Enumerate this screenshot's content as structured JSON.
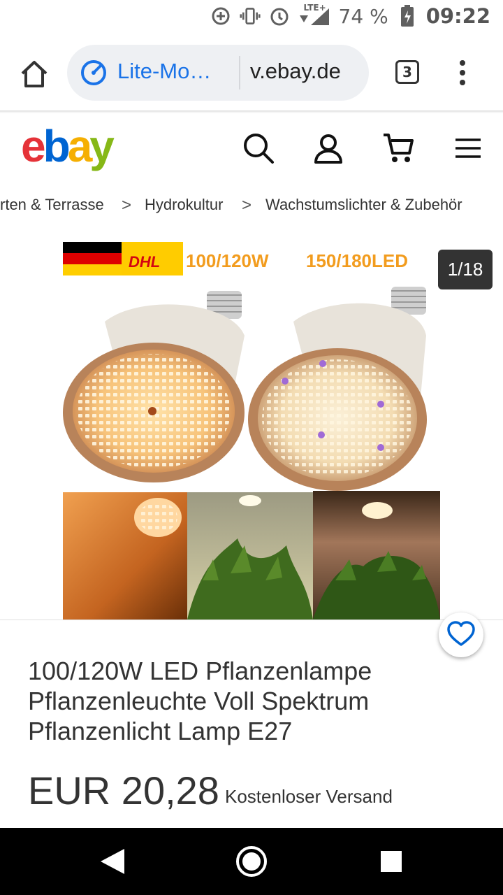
{
  "status_bar": {
    "icons": [
      "data-saver-icon",
      "vibrate-icon",
      "alarm-icon",
      "signal-icon",
      "battery-icon"
    ],
    "network": "LTE+",
    "battery": "74 %",
    "time": "09:22"
  },
  "browser": {
    "lite_mode_label": "Lite-Mo…",
    "url": "v.ebay.de",
    "tab_count": "3"
  },
  "ebay": {
    "logo": {
      "e": "e",
      "b": "b",
      "a": "a",
      "y": "y"
    },
    "icons": [
      "search-icon",
      "account-icon",
      "cart-icon",
      "hamburger-menu-icon"
    ]
  },
  "breadcrumb": {
    "items": [
      "rten & Terrasse",
      "Hydrokultur",
      "Wachstumslichter & Zubehör"
    ],
    "separator": ">"
  },
  "gallery": {
    "banner_text_1": "100/120W",
    "banner_text_2": "150/180LED",
    "banner_brand": "DHL",
    "counter": "1/18"
  },
  "product": {
    "title_lines": [
      "100/120W LED Pflanzenlampe",
      "Pflanzenleuchte Voll Spektrum",
      "Pflanzenlicht Lamp E27"
    ],
    "price": "EUR 20,28",
    "shipping": "Kostenloser Versand"
  },
  "colors": {
    "accent_blue": "#1a73e8",
    "ebay_red": "#e53238",
    "ebay_blue": "#0064d2",
    "ebay_yellow": "#f5af02",
    "ebay_green": "#86b817",
    "banner_orange": "#f29c1e"
  }
}
